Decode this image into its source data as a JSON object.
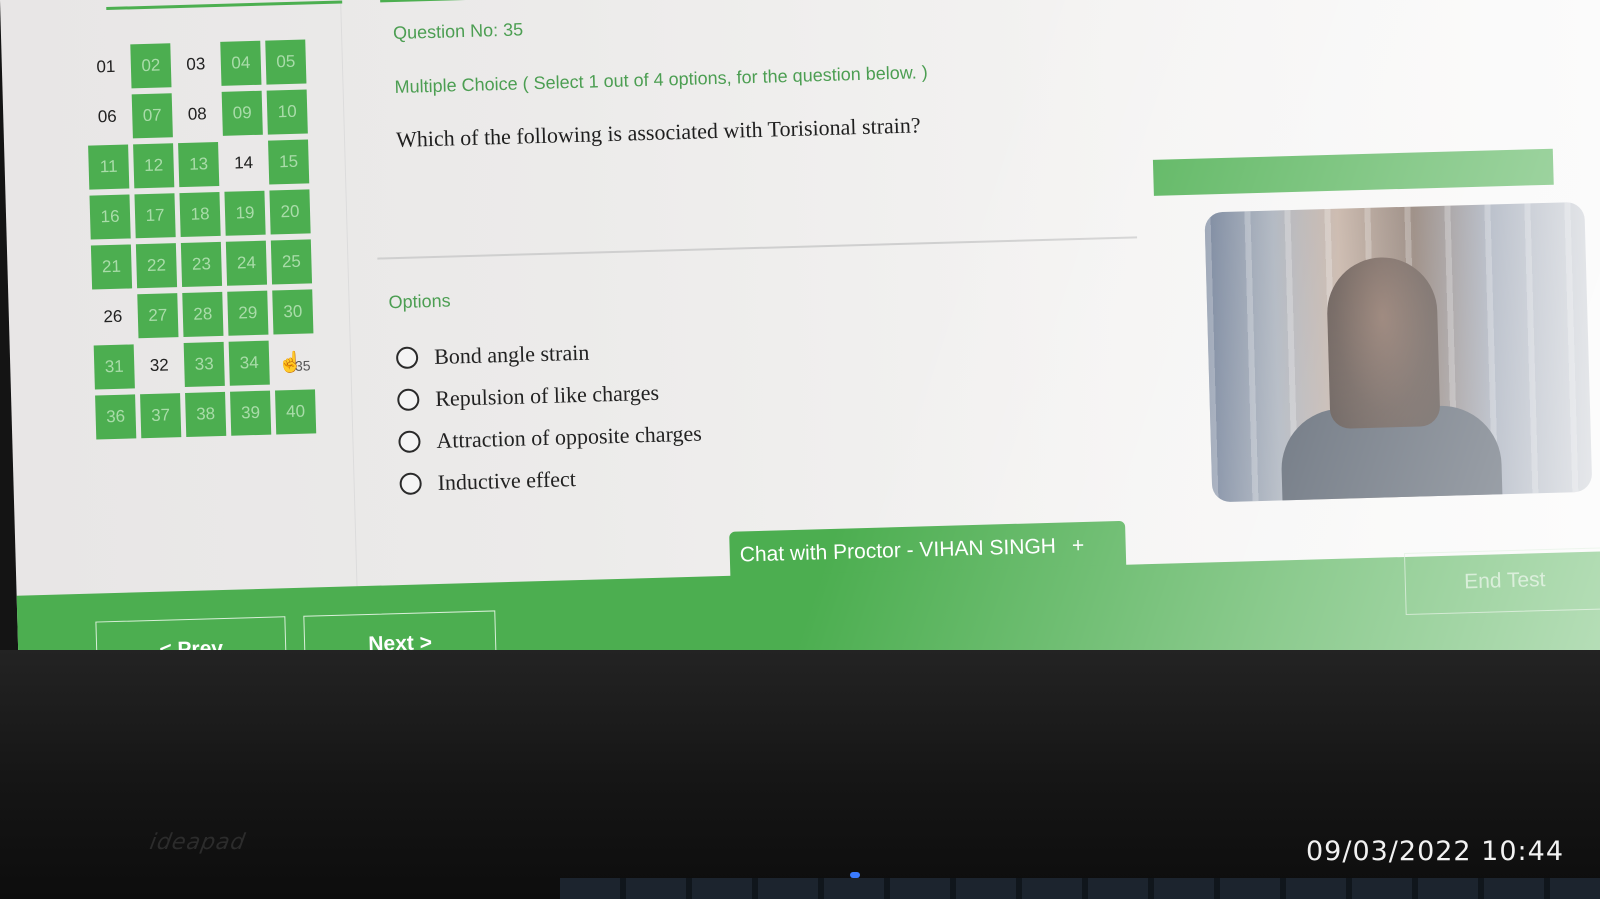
{
  "question_nav": {
    "cells": [
      {
        "label": "01",
        "state": "not-answered"
      },
      {
        "label": "02",
        "state": "answered"
      },
      {
        "label": "03",
        "state": "not-answered"
      },
      {
        "label": "04",
        "state": "answered"
      },
      {
        "label": "05",
        "state": "answered"
      },
      {
        "label": "06",
        "state": "not-answered"
      },
      {
        "label": "07",
        "state": "answered"
      },
      {
        "label": "08",
        "state": "not-answered"
      },
      {
        "label": "09",
        "state": "answered"
      },
      {
        "label": "10",
        "state": "answered"
      },
      {
        "label": "11",
        "state": "answered"
      },
      {
        "label": "12",
        "state": "answered"
      },
      {
        "label": "13",
        "state": "answered"
      },
      {
        "label": "14",
        "state": "not-answered"
      },
      {
        "label": "15",
        "state": "answered"
      },
      {
        "label": "16",
        "state": "answered"
      },
      {
        "label": "17",
        "state": "answered"
      },
      {
        "label": "18",
        "state": "answered"
      },
      {
        "label": "19",
        "state": "answered"
      },
      {
        "label": "20",
        "state": "answered"
      },
      {
        "label": "21",
        "state": "answered"
      },
      {
        "label": "22",
        "state": "answered"
      },
      {
        "label": "23",
        "state": "answered"
      },
      {
        "label": "24",
        "state": "answered"
      },
      {
        "label": "25",
        "state": "answered"
      },
      {
        "label": "26",
        "state": "not-answered"
      },
      {
        "label": "27",
        "state": "answered"
      },
      {
        "label": "28",
        "state": "answered"
      },
      {
        "label": "29",
        "state": "answered"
      },
      {
        "label": "30",
        "state": "answered"
      },
      {
        "label": "31",
        "state": "answered"
      },
      {
        "label": "32",
        "state": "not-answered"
      },
      {
        "label": "33",
        "state": "answered"
      },
      {
        "label": "34",
        "state": "answered"
      },
      {
        "label": "35",
        "state": "current"
      },
      {
        "label": "36",
        "state": "answered"
      },
      {
        "label": "37",
        "state": "answered"
      },
      {
        "label": "38",
        "state": "answered"
      },
      {
        "label": "39",
        "state": "answered"
      },
      {
        "label": "40",
        "state": "answered"
      }
    ]
  },
  "question": {
    "number_label": "Question No: 35",
    "type_label": "Multiple Choice ( Select 1 out of 4 options, for the question below. )",
    "text": "Which of the following is associated with Torisional strain?"
  },
  "options": {
    "heading": "Options",
    "items": [
      {
        "label": "Bond angle strain"
      },
      {
        "label": "Repulsion of like charges"
      },
      {
        "label": "Attraction of opposite charges"
      },
      {
        "label": "Inductive effect"
      }
    ]
  },
  "chat": {
    "label": "Chat with Proctor - VIHAN SINGH",
    "plus": "+"
  },
  "nav_buttons": {
    "prev": "< Prev",
    "next": "Next >",
    "end_test": "End Test"
  },
  "photo_overlay": {
    "timestamp": "09/03/2022 10:44"
  },
  "colors": {
    "accent_green": "#4cae50",
    "question_label_green": "#4c9e52"
  },
  "icons": {
    "hand_cursor": "pointing-hand-icon"
  }
}
